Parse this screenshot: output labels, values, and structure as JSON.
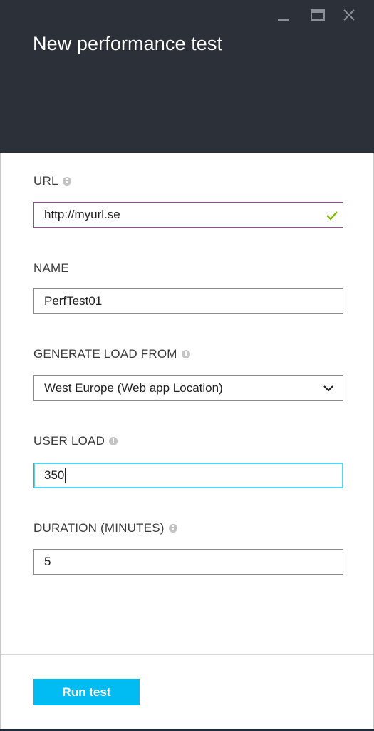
{
  "window": {
    "title": "New performance test",
    "controls": {
      "minimize": "minimize-icon",
      "maximize": "maximize-icon",
      "close": "close-icon"
    }
  },
  "form": {
    "url": {
      "label": "URL",
      "value": "http://myurl.se",
      "validated": true
    },
    "name": {
      "label": "NAME",
      "value": "PerfTest01"
    },
    "generate_load_from": {
      "label": "GENERATE LOAD FROM",
      "selected": "West Europe (Web app Location)"
    },
    "user_load": {
      "label": "USER LOAD",
      "value": "350"
    },
    "duration": {
      "label": "DURATION (MINUTES)",
      "value": "5"
    }
  },
  "footer": {
    "run_label": "Run test"
  },
  "colors": {
    "header_bg": "#2c3038",
    "accent": "#00bcf2",
    "validated_border": "#a0479a",
    "focus_border": "#1fb6d9",
    "check": "#7fba00"
  }
}
